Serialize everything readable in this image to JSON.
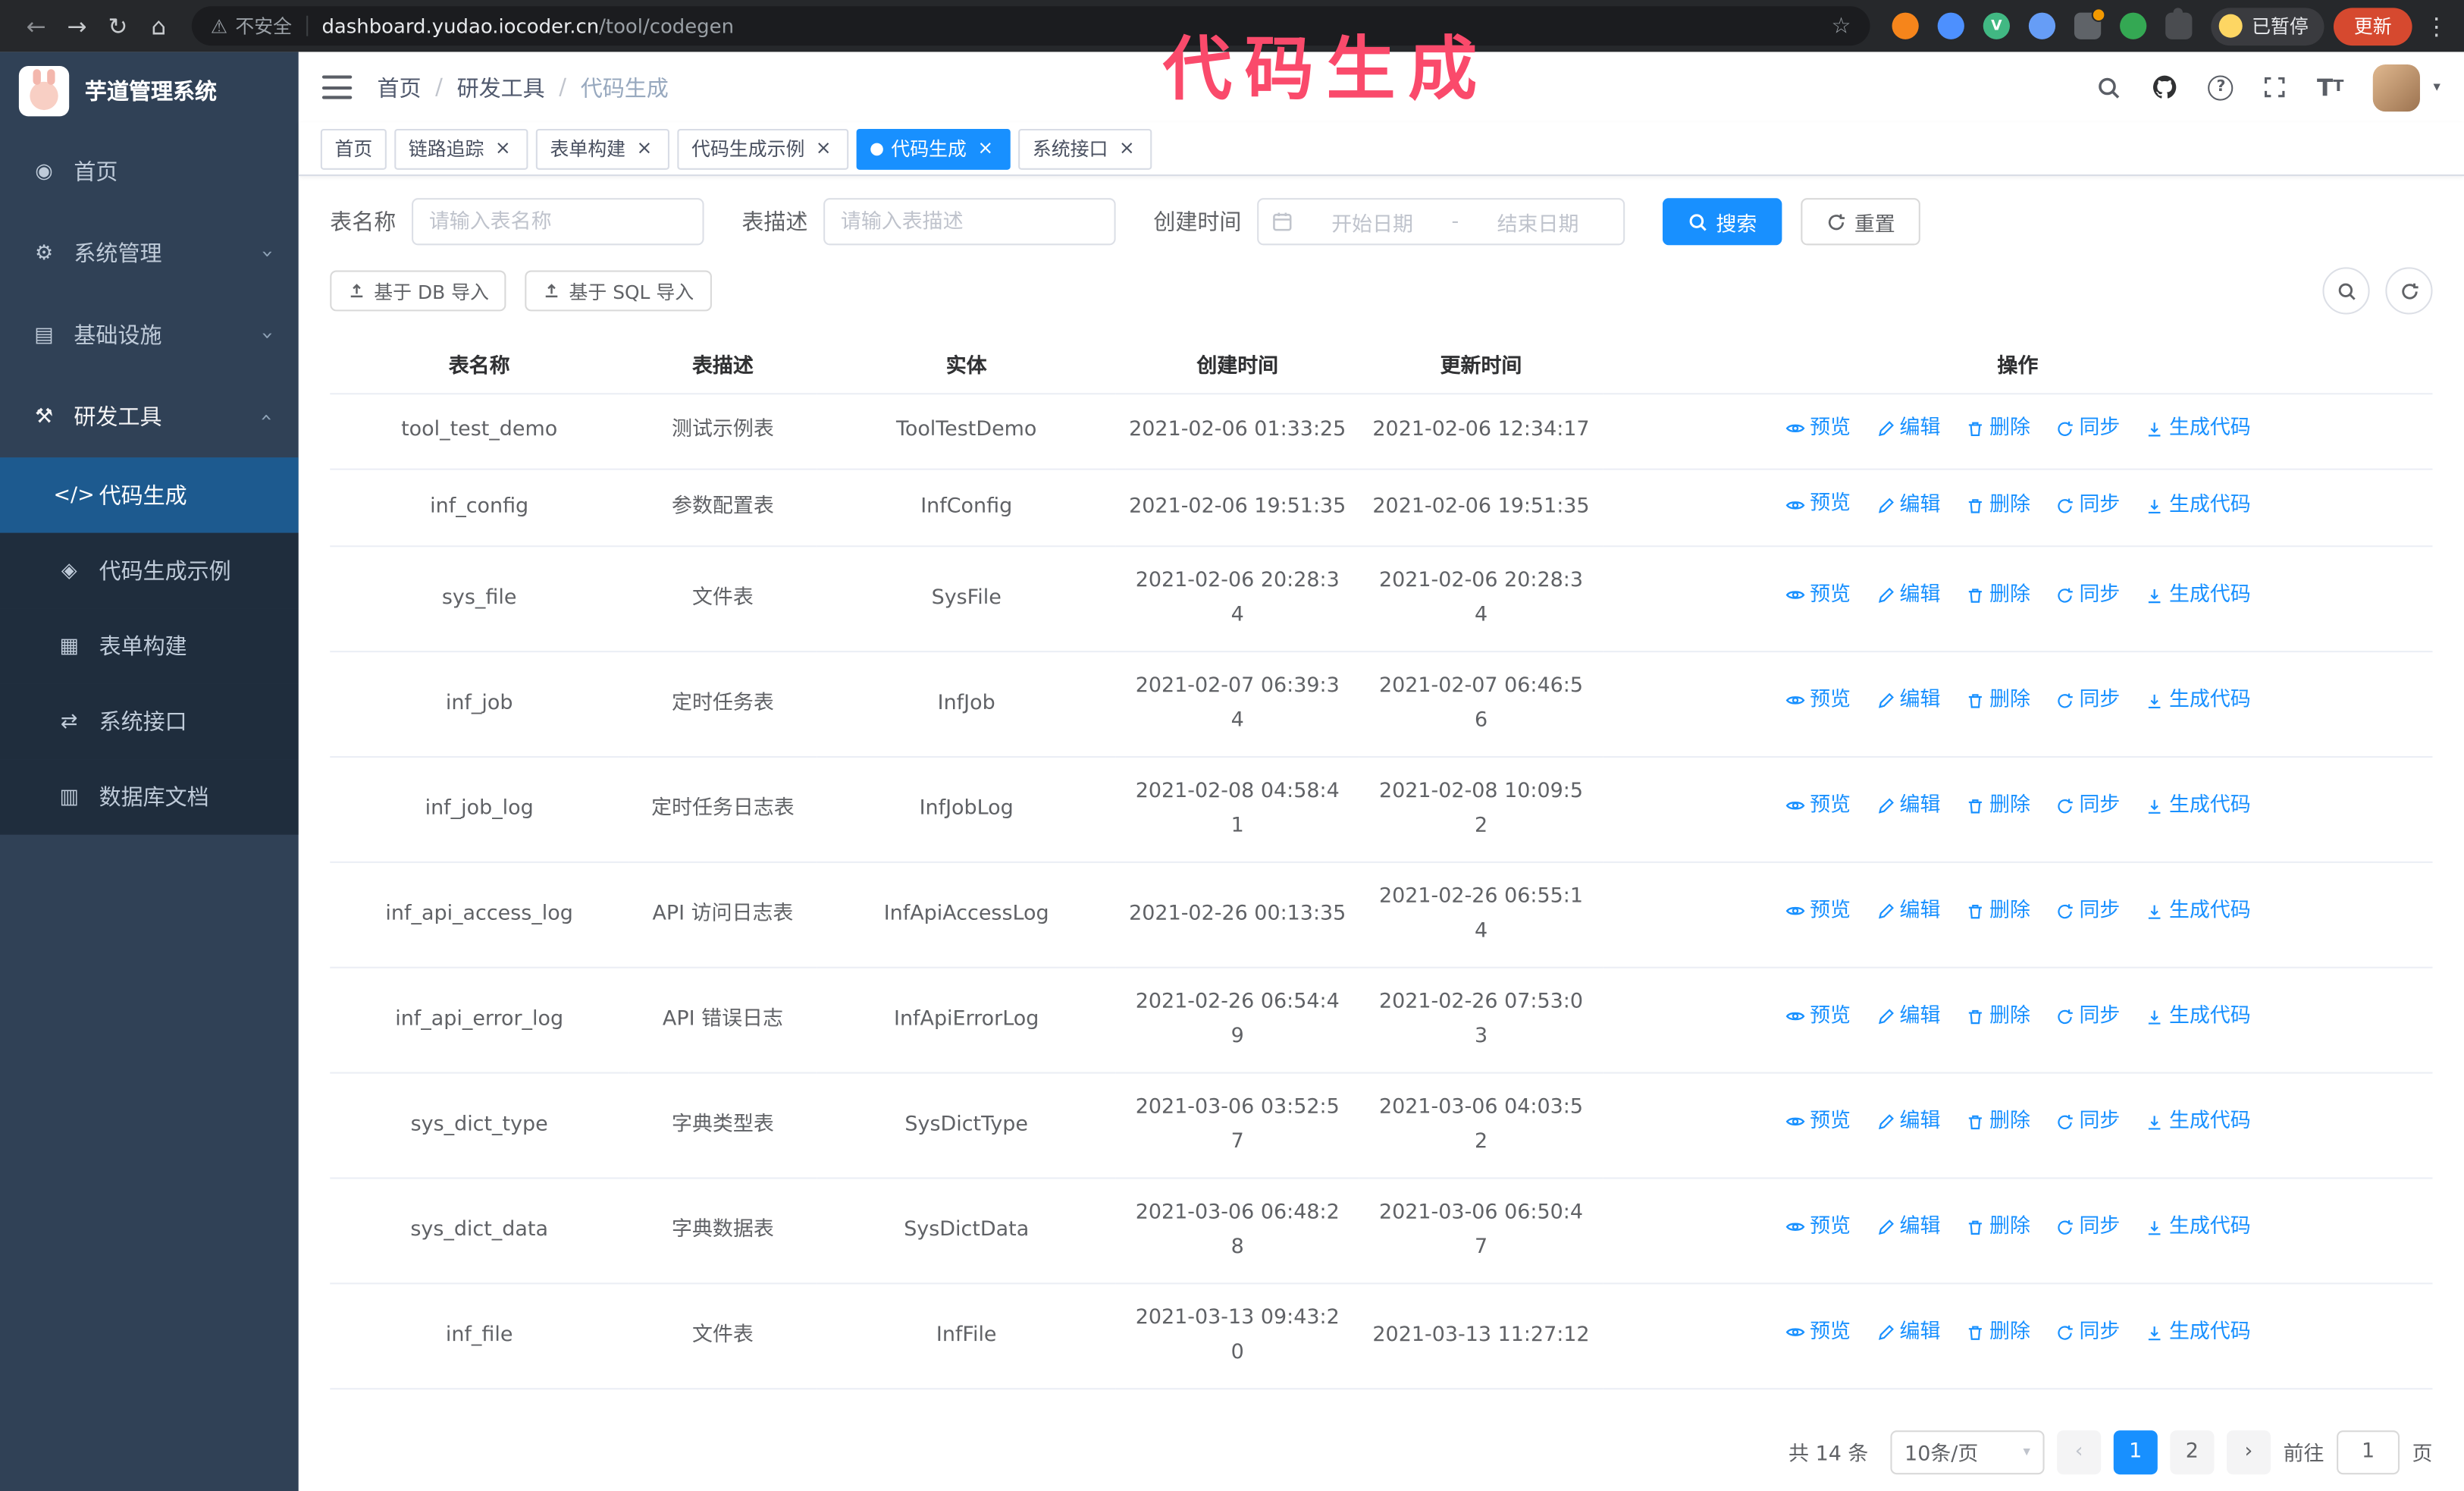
{
  "colors": {
    "primary": "#1890ff",
    "sidebar_bg": "#304156",
    "sidebar_submenu_bg": "#1f2d3d",
    "sidebar_active_bg": "#1d5a8f",
    "annotation": "#fa4a6b"
  },
  "annotation": {
    "text": "代码生成"
  },
  "browser": {
    "security_text": "不安全",
    "url_host": "dashboard.yudao.iocoder.cn",
    "url_path": "/tool/codegen",
    "paused_badge": "已暂停",
    "update_button": "更新"
  },
  "sidebar": {
    "logo_title": "芋道管理系统",
    "items": [
      {
        "label": "首页",
        "icon": "home"
      },
      {
        "label": "系统管理",
        "icon": "system",
        "chevron": true
      },
      {
        "label": "基础设施",
        "icon": "infra",
        "chevron": true
      },
      {
        "label": "研发工具",
        "icon": "tools",
        "chevron": true,
        "up": true,
        "open": true
      },
      {
        "label": "代码生成",
        "icon": "code",
        "sub": true,
        "active": true
      },
      {
        "label": "代码生成示例",
        "icon": "example",
        "sub": true
      },
      {
        "label": "表单构建",
        "icon": "form",
        "sub": true
      },
      {
        "label": "系统接口",
        "icon": "api",
        "sub": true
      },
      {
        "label": "数据库文档",
        "icon": "db",
        "sub": true
      }
    ]
  },
  "header": {
    "breadcrumb": [
      "首页",
      "研发工具",
      "代码生成"
    ]
  },
  "tags": [
    {
      "label": "首页",
      "closable": false,
      "active": false
    },
    {
      "label": "链路追踪",
      "closable": true,
      "active": false
    },
    {
      "label": "表单构建",
      "closable": true,
      "active": false
    },
    {
      "label": "代码生成示例",
      "closable": true,
      "active": false
    },
    {
      "label": "代码生成",
      "closable": true,
      "active": true
    },
    {
      "label": "系统接口",
      "closable": true,
      "active": false
    }
  ],
  "filters": {
    "table_name_label": "表名称",
    "table_name_placeholder": "请输入表名称",
    "table_desc_label": "表描述",
    "table_desc_placeholder": "请输入表描述",
    "create_time_label": "创建时间",
    "start_placeholder": "开始日期",
    "range_separator": "-",
    "end_placeholder": "结束日期",
    "search_label": "搜索",
    "reset_label": "重置"
  },
  "toolbar": {
    "import_db": "基于 DB 导入",
    "import_sql": "基于 SQL 导入"
  },
  "table": {
    "columns": [
      "表名称",
      "表描述",
      "实体",
      "创建时间",
      "更新时间",
      "操作"
    ],
    "op_labels": {
      "preview": "预览",
      "edit": "编辑",
      "delete": "删除",
      "sync": "同步",
      "generate": "生成代码"
    },
    "rows": [
      {
        "name": "tool_test_demo",
        "desc": "测试示例表",
        "entity": "ToolTestDemo",
        "created": "2021-02-06 01:33:25",
        "updated": "2021-02-06 12:34:17"
      },
      {
        "name": "inf_config",
        "desc": "参数配置表",
        "entity": "InfConfig",
        "created": "2021-02-06 19:51:35",
        "updated": "2021-02-06 19:51:35"
      },
      {
        "name": "sys_file",
        "desc": "文件表",
        "entity": "SysFile",
        "created": "2021-02-06 20:28:3\n4",
        "updated": "2021-02-06 20:28:3\n4"
      },
      {
        "name": "inf_job",
        "desc": "定时任务表",
        "entity": "InfJob",
        "created": "2021-02-07 06:39:3\n4",
        "updated": "2021-02-07 06:46:5\n6"
      },
      {
        "name": "inf_job_log",
        "desc": "定时任务日志表",
        "entity": "InfJobLog",
        "created": "2021-02-08 04:58:4\n1",
        "updated": "2021-02-08 10:09:5\n2"
      },
      {
        "name": "inf_api_access_log",
        "desc": "API 访问日志表",
        "entity": "InfApiAccessLog",
        "created": "2021-02-26 00:13:35",
        "updated": "2021-02-26 06:55:1\n4"
      },
      {
        "name": "inf_api_error_log",
        "desc": "API 错误日志",
        "entity": "InfApiErrorLog",
        "created": "2021-02-26 06:54:4\n9",
        "updated": "2021-02-26 07:53:0\n3"
      },
      {
        "name": "sys_dict_type",
        "desc": "字典类型表",
        "entity": "SysDictType",
        "created": "2021-03-06 03:52:5\n7",
        "updated": "2021-03-06 04:03:5\n2"
      },
      {
        "name": "sys_dict_data",
        "desc": "字典数据表",
        "entity": "SysDictData",
        "created": "2021-03-06 06:48:2\n8",
        "updated": "2021-03-06 06:50:4\n7"
      },
      {
        "name": "inf_file",
        "desc": "文件表",
        "entity": "InfFile",
        "created": "2021-03-13 09:43:2\n0",
        "updated": "2021-03-13 11:27:12"
      }
    ]
  },
  "pagination": {
    "total_text": "共 14 条",
    "page_size": "10条/页",
    "pages": [
      {
        "label": "1",
        "active": true
      },
      {
        "label": "2",
        "active": false
      }
    ],
    "goto_label": "前往",
    "goto_value": "1",
    "goto_suffix": "页"
  }
}
